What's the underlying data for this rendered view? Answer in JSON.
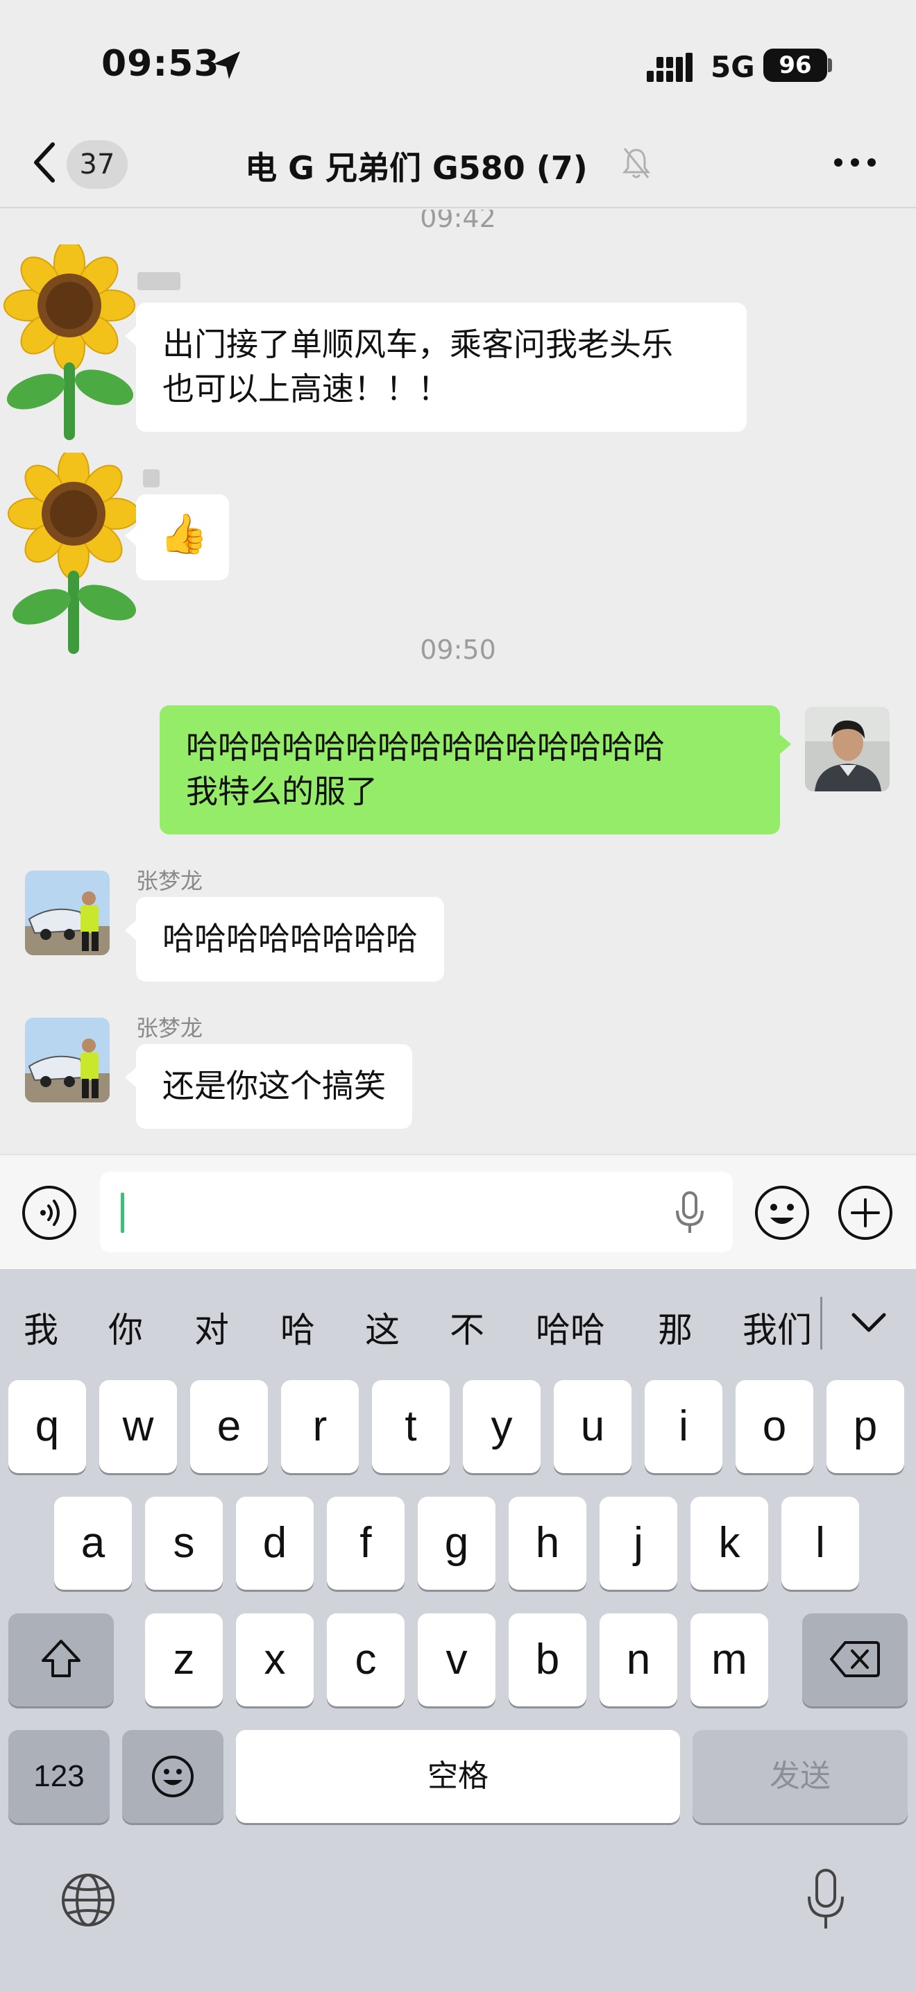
{
  "status_bar": {
    "time": "09:53",
    "network": "5G",
    "battery": "96"
  },
  "nav": {
    "unread_count": "37",
    "title": "电 G 兄弟们 G580 (7)"
  },
  "chat": {
    "timestamps": [
      "09:42",
      "09:50"
    ],
    "messages": [
      {
        "sender": "",
        "text": "出门接了单顺风车，乘客问我老头乐也可以上高速！！！",
        "line1": "出门接了单顺风车，乘客问我老头乐",
        "line2": "也可以上高速！！！"
      },
      {
        "sender": "",
        "text": "👍"
      },
      {
        "sender": "me",
        "line1": "哈哈哈哈哈哈哈哈哈哈哈哈哈哈哈",
        "line2": "我特么的服了"
      },
      {
        "sender": "张梦龙",
        "text": "哈哈哈哈哈哈哈哈"
      },
      {
        "sender": "张梦龙",
        "text": "还是你这个搞笑"
      }
    ]
  },
  "input": {
    "value": "",
    "placeholder": ""
  },
  "keyboard": {
    "candidates": [
      "我",
      "你",
      "对",
      "哈",
      "这",
      "不",
      "哈哈",
      "那",
      "我们"
    ],
    "row1": [
      "q",
      "w",
      "e",
      "r",
      "t",
      "y",
      "u",
      "i",
      "o",
      "p"
    ],
    "row2": [
      "a",
      "s",
      "d",
      "f",
      "g",
      "h",
      "j",
      "k",
      "l"
    ],
    "row3": [
      "z",
      "x",
      "c",
      "v",
      "b",
      "n",
      "m"
    ],
    "numbers_key": "123",
    "space_key": "空格",
    "send_key": "发送"
  }
}
